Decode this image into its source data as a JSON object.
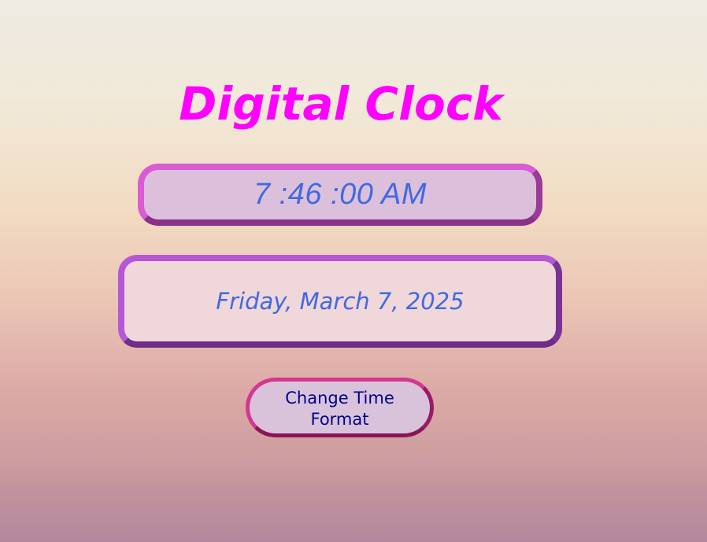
{
  "header": {
    "title": "Digital Clock"
  },
  "clock": {
    "time": "7 :46 :00 AM",
    "date": "Friday, March 7, 2025"
  },
  "controls": {
    "format_button_label": "Change Time Format"
  },
  "colors": {
    "title": "#ff00ff",
    "clock_text": "#4169e1",
    "button_text": "#00008b",
    "time_border": "#d95cd4",
    "date_border": "#b558d6",
    "button_border": "#d2388f"
  }
}
